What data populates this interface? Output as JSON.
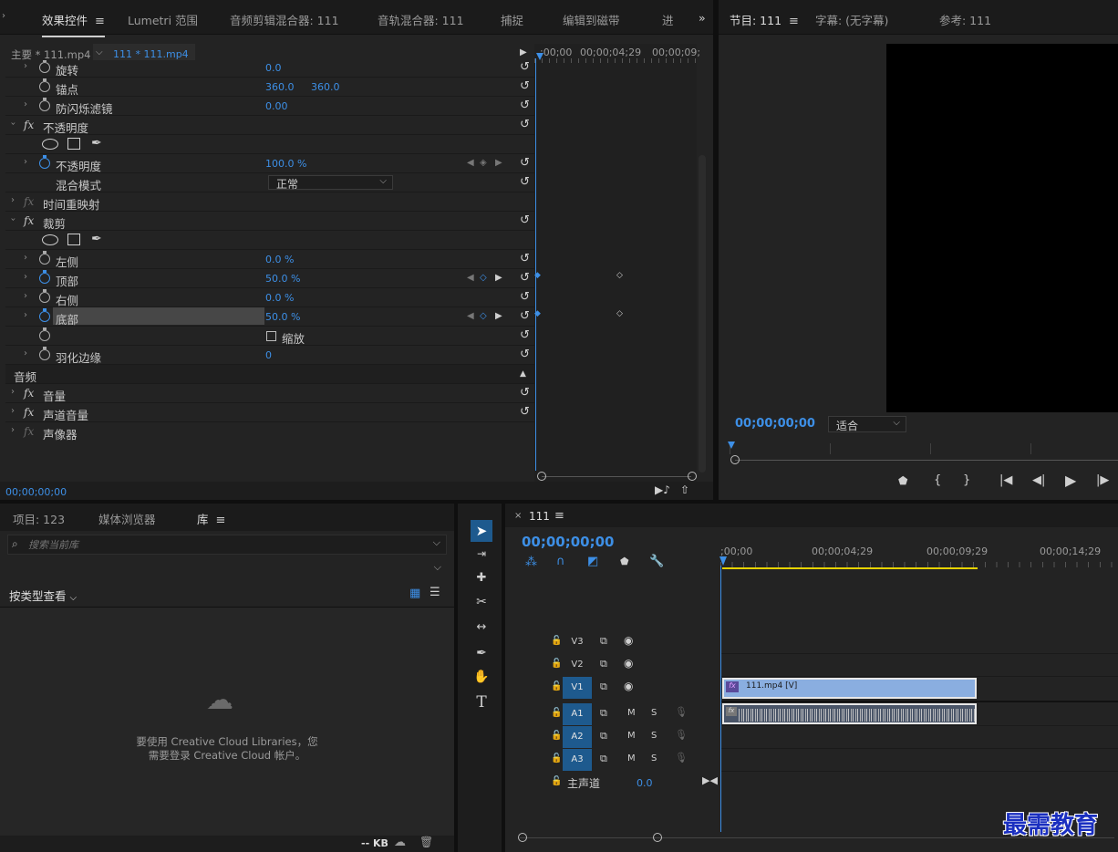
{
  "effect_controls": {
    "tabs": [
      "效果控件",
      "Lumetri 范围",
      "音频剪辑混合器: 111",
      "音轨混合器: 111",
      "捕捉",
      "编辑到磁带",
      "进"
    ],
    "source_label": "主要 * 111.mp4",
    "clip_label": "111 * 111.mp4",
    "ruler_labels": [
      ";00;00",
      "00;00;04;29",
      "00;00;09;"
    ],
    "rows": {
      "rotation": {
        "label": "旋转",
        "value": "0.0"
      },
      "anchor": {
        "label": "锚点",
        "value1": "360.0",
        "value2": "360.0"
      },
      "antiflicker": {
        "label": "防闪烁滤镜",
        "value": "0.00"
      },
      "opacity_group": {
        "label": "不透明度"
      },
      "opacity": {
        "label": "不透明度",
        "value": "100.0 %"
      },
      "blend": {
        "label": "混合模式",
        "value": "正常"
      },
      "timeremap": {
        "label": "时间重映射"
      },
      "crop_group": {
        "label": "裁剪"
      },
      "left": {
        "label": "左侧",
        "value": "0.0 %"
      },
      "top": {
        "label": "顶部",
        "value": "50.0 %"
      },
      "right": {
        "label": "右侧",
        "value": "0.0 %"
      },
      "bottom": {
        "label": "底部",
        "value": "50.0 %"
      },
      "zoom": {
        "label": "缩放"
      },
      "feather": {
        "label": "羽化边缘",
        "value": "0"
      },
      "audio_header": {
        "label": "音频"
      },
      "volume": {
        "label": "音量"
      },
      "channel_volume": {
        "label": "声道音量"
      },
      "panner": {
        "label": "声像器"
      }
    },
    "timecode": "00;00;00;00"
  },
  "program": {
    "tabs": [
      "节目: 111",
      "字幕: (无字幕)",
      "参考: 111"
    ],
    "timecode": "00;00;00;00",
    "fit": "适合"
  },
  "library": {
    "tabs": [
      "项目: 123",
      "媒体浏览器",
      "库"
    ],
    "search_placeholder": "搜索当前库",
    "view_by": "按类型查看",
    "message_line1": "要使用 Creative Cloud Libraries，您",
    "message_line2": "需要登录 Creative Cloud 帐户。",
    "storage": "-- KB"
  },
  "timeline": {
    "sequence": "111",
    "timecode": "00;00;00;00",
    "ruler_labels": [
      ";00;00",
      "00;00;04;29",
      "00;00;09;29",
      "00;00;14;29"
    ],
    "video_tracks": [
      "V3",
      "V2",
      "V1"
    ],
    "audio_tracks": [
      "A1",
      "A2",
      "A3"
    ],
    "master_label": "主声道",
    "master_value": "0.0",
    "clip_video": "111.mp4 [V]",
    "m_label": "M",
    "s_label": "S"
  },
  "watermark": "最需教育"
}
